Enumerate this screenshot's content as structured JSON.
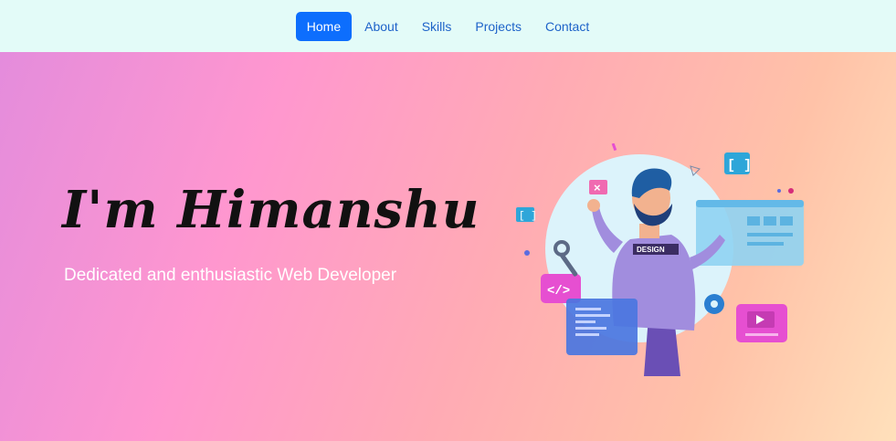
{
  "nav": {
    "items": [
      {
        "label": "Home",
        "active": true
      },
      {
        "label": "About",
        "active": false
      },
      {
        "label": "Skills",
        "active": false
      },
      {
        "label": "Projects",
        "active": false
      },
      {
        "label": "Contact",
        "active": false
      }
    ]
  },
  "hero": {
    "title": "I'm Himanshu",
    "subtitle": "Dedicated and enthusiastic Web Developer",
    "illustration_shirt_text": "DESIGN"
  },
  "colors": {
    "nav_bg": "#e3fbf8",
    "nav_link": "#1e63c9",
    "nav_active_bg": "#0d6efd",
    "hero_gradient_start": "#e48cdc",
    "hero_gradient_end": "#ffe0bb"
  }
}
